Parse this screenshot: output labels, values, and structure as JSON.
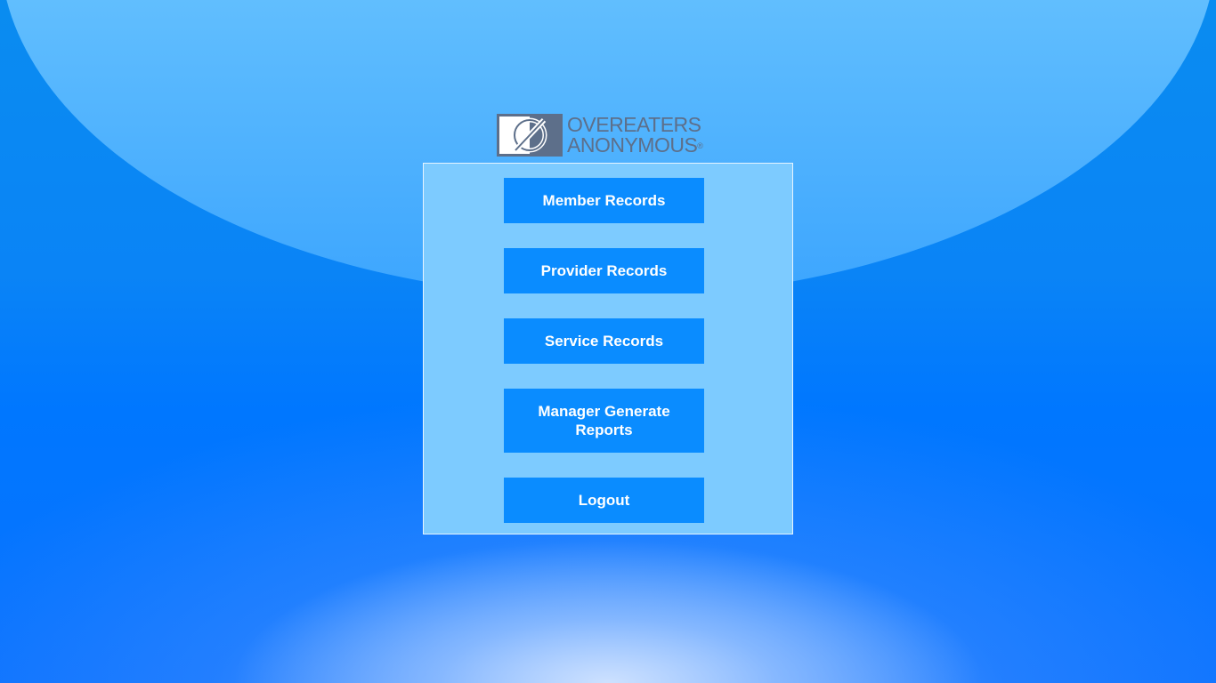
{
  "logo": {
    "line1": "OVEREATERS",
    "line2": "ANONYMOUS",
    "registered": "®"
  },
  "menu": {
    "items": [
      {
        "label": "Member Records"
      },
      {
        "label": "Provider Records"
      },
      {
        "label": "Service Records"
      },
      {
        "label": "Manager Generate Reports"
      },
      {
        "label": "Logout"
      }
    ]
  },
  "colors": {
    "button": "#0a8cff",
    "panel": "#7dcbff",
    "logo": "#5d6f8a"
  }
}
